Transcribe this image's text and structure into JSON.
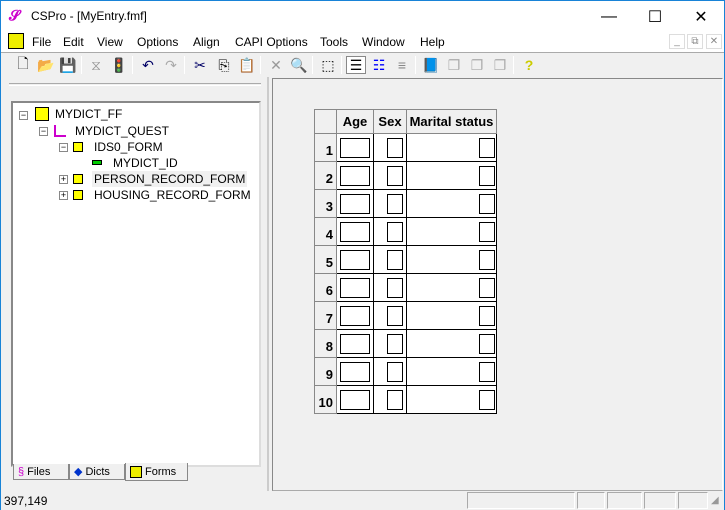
{
  "window": {
    "title": "CSPro - [MyEntry.fmf]"
  },
  "menu": [
    {
      "label": "File"
    },
    {
      "label": "Edit"
    },
    {
      "label": "View"
    },
    {
      "label": "Options"
    },
    {
      "label": "Align"
    },
    {
      "label": "CAPI Options"
    },
    {
      "label": "Tools"
    },
    {
      "label": "Window"
    },
    {
      "label": "Help"
    }
  ],
  "tree": {
    "root": "MYDICT_FF",
    "quest": "MYDICT_QUEST",
    "ids": "IDS0_FORM",
    "id_item": "MYDICT_ID",
    "person": "PERSON_RECORD_FORM",
    "housing": "HOUSING_RECORD_FORM"
  },
  "tabs": {
    "files": "Files",
    "dicts": "Dicts",
    "forms": "Forms"
  },
  "grid": {
    "headers": [
      "Age",
      "Sex",
      "Marital status"
    ],
    "rows": [
      "1",
      "2",
      "3",
      "4",
      "5",
      "6",
      "7",
      "8",
      "9",
      "10"
    ]
  },
  "status": {
    "coords": "397,149"
  }
}
